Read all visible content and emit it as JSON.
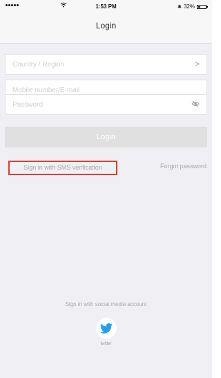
{
  "status_bar": {
    "time": "1:53 PM",
    "battery_percent_label": "32%",
    "battery_level": 0.32,
    "wifi_icon": "wifi-icon",
    "bluetooth_icon": "bluetooth-icon"
  },
  "header": {
    "title": "Login"
  },
  "form": {
    "country_placeholder": "Country / Region",
    "country_chevron": ">",
    "mobile_placeholder": "Mobile number/E-mail",
    "password_placeholder": "Password",
    "password_icon": "eye-slash-icon",
    "login_label": "Login"
  },
  "links": {
    "sms_signin": "Sign in with SMS verification",
    "forgot_password": "Forgot password"
  },
  "social": {
    "label": "Sign in with social media account",
    "twitter_label": "twitter",
    "twitter_color": "#1da1f2"
  },
  "colors": {
    "highlight_border": "#e23b2e",
    "disabled_button": "#e0e0e0"
  }
}
